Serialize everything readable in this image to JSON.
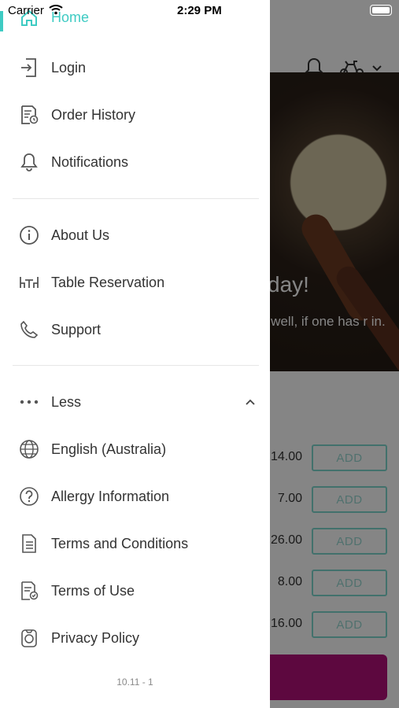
{
  "status_bar": {
    "carrier": "Carrier",
    "time": "2:29 PM"
  },
  "background": {
    "hero_title": "day!",
    "hero_subtitle": "o well, if one has r in.",
    "prices": [
      "14.00",
      "7.00",
      "26.00",
      "8.00",
      "16.00"
    ],
    "add_label": "ADD",
    "accent_color": "#3ecbc3",
    "checkout_color": "#b2117a"
  },
  "drawer": {
    "home_label": "Home",
    "section1": [
      {
        "label": "Login",
        "icon": "login-icon"
      },
      {
        "label": "Order History",
        "icon": "order-history-icon"
      },
      {
        "label": "Notifications",
        "icon": "bell-icon"
      }
    ],
    "section2": [
      {
        "label": "About Us",
        "icon": "info-icon"
      },
      {
        "label": "Table Reservation",
        "icon": "table-icon"
      },
      {
        "label": "Support",
        "icon": "phone-icon"
      }
    ],
    "less_label": "Less",
    "section3": [
      {
        "label": "English (Australia)",
        "icon": "globe-icon"
      },
      {
        "label": "Allergy Information",
        "icon": "question-icon"
      },
      {
        "label": "Terms and Conditions",
        "icon": "document-icon"
      },
      {
        "label": "Terms of Use",
        "icon": "terms-of-use-icon"
      },
      {
        "label": "Privacy Policy",
        "icon": "privacy-icon"
      }
    ],
    "version": "10.11 - 1"
  }
}
